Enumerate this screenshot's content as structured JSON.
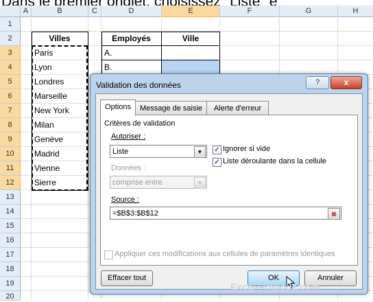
{
  "caption": "Dans le premier onglet, choisissez \"Liste\" e",
  "columns": [
    "A",
    "B",
    "C",
    "D",
    "E",
    "F",
    "G",
    "H"
  ],
  "rows": [
    "1",
    "2",
    "3",
    "4",
    "5",
    "6",
    "7",
    "8",
    "9",
    "10",
    "11",
    "12",
    "13",
    "14",
    "15",
    "16",
    "17",
    "18",
    "19",
    "20"
  ],
  "villes": {
    "header": "Villes",
    "items": [
      "Paris",
      "Lyon",
      "Londres",
      "Marseille",
      "New York",
      "Milan",
      "Genève",
      "Madrid",
      "Vienne",
      "Sierre"
    ]
  },
  "employes": {
    "header_name": "Employés",
    "header_ville": "Ville",
    "items": [
      "A.",
      "B."
    ]
  },
  "dialog": {
    "title": "Validation des données",
    "help": "?",
    "close": "x",
    "tabs": [
      "Options",
      "Message de saisie",
      "Alerte d'erreur"
    ],
    "criteria_label": "Critères de validation",
    "allow_label": "Autoriser :",
    "allow_value": "Liste",
    "ignore_blank": "Ignorer si vide",
    "dropdown_in_cell": "Liste déroulante dans la cellule",
    "data_label": "Données :",
    "data_value": "comprise entre",
    "source_label": "Source :",
    "source_value": "=$B$3:$B$12",
    "apply_all": "Appliquer ces modifications aux cellules de paramètres identiques",
    "clear_all": "Effacer tout",
    "ok": "OK",
    "cancel": "Annuler"
  },
  "watermark": "Excel-Pratique.com",
  "colors": {
    "header_bg": "#e4ecf7",
    "selected_header": "#f9d99f",
    "selection": "#b9d3f3",
    "dialog_frame": "#bcd3eb"
  }
}
